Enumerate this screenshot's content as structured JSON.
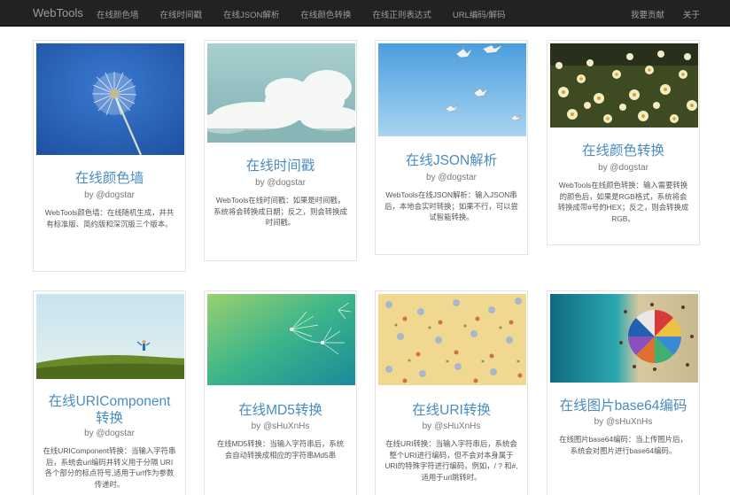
{
  "navbar": {
    "brand": "WebTools",
    "left_links": [
      "在线颜色墙",
      "在线时间戳",
      "在线JSON解析",
      "在线颜色转换",
      "在线正则表达式",
      "URL编码/解码"
    ],
    "right_links": [
      "我要贡献",
      "关于"
    ]
  },
  "cards": [
    {
      "title": "在线颜色墙",
      "author": "by @dogstar",
      "description": "WebTools颜色墙：在线随机生成，并共有标准版、简约版和深沉版三个版本。",
      "image": "dandelion-photo"
    },
    {
      "title": "在线时间戳",
      "author": "by @dogstar",
      "description": "WebTools在线时间戳：如果是时间戳，系统将会转换成日期；反之，则会转换成时间戳。",
      "image": "clouds-photo"
    },
    {
      "title": "在线JSON解析",
      "author": "by @dogstar",
      "description": "WebTools在线JSON解析：输入JSON串后，本地会实时转换；如果不行，可以尝试智能转换。",
      "image": "seagulls-photo"
    },
    {
      "title": "在线颜色转换",
      "author": "by @dogstar",
      "description": "WebTools在线颜色转换：输入需要转换的颜色后，如果是RGB格式，系统将会转换成带#号的HEX；反之，则会转换成RGB。",
      "image": "daisies-photo"
    },
    {
      "title": "在线URIComponent转换",
      "author": "by @dogstar",
      "description": "在线URIComponent转换：当输入字符串后，系统会url编码并转义用于分隔 URI 各个部分的标点符号,适用于url作为参数传递时。",
      "image": "hill-child-photo"
    },
    {
      "title": "在线MD5转换",
      "author": "by @sHuXnHs",
      "description": "在线MD5转换：当输入字符串后，系统会自动转换成相应的字符串Md5串",
      "image": "dandelion-seeds-green-photo"
    },
    {
      "title": "在线URI转换",
      "author": "by @sHuXnHs",
      "description": "在线URI转换：当输入字符串后，系统会整个URI进行编码，但不会对本身属于URI的特殊字符进行编码，例如，/ ? 和#,适用于url跳转时。",
      "image": "floral-pattern-photo"
    },
    {
      "title": "在线图片base64编码",
      "author": "by @sHuXnHs",
      "description": "在线图片base64编码：当上传图片后，系统会对图片进行base64编码。",
      "image": "beach-umbrella-photo"
    }
  ]
}
